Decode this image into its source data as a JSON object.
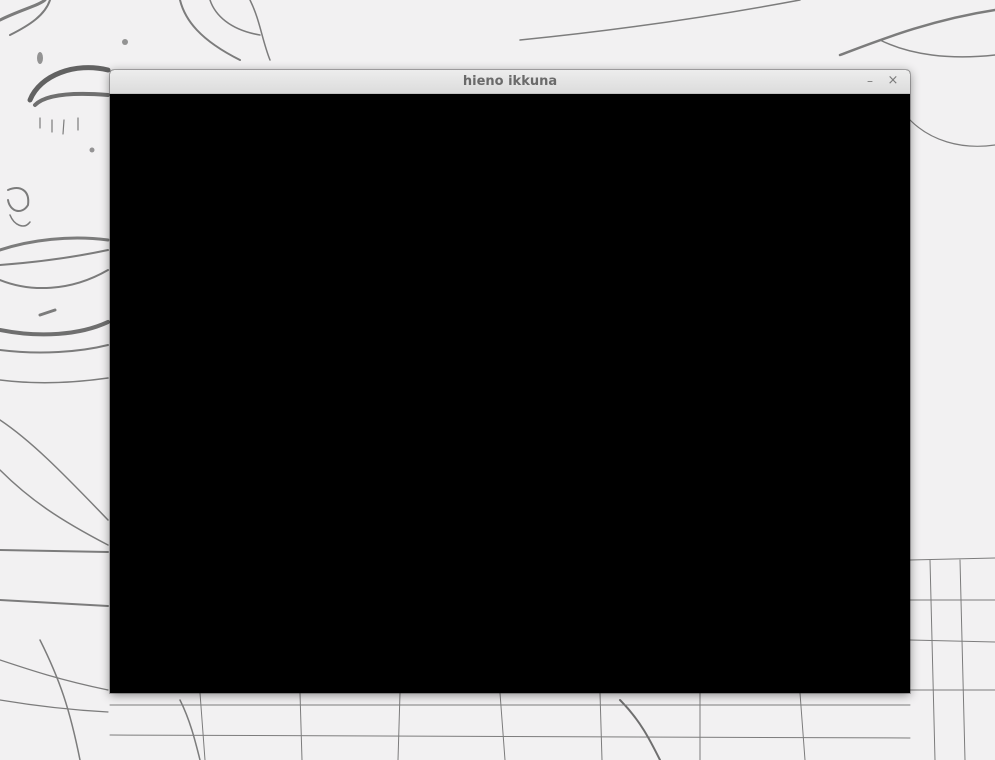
{
  "window": {
    "title": "hieno ikkuna",
    "minimize_glyph": "–",
    "close_glyph": "×",
    "content_color": "#000000"
  },
  "icons": [
    "minimize-icon",
    "close-icon"
  ]
}
